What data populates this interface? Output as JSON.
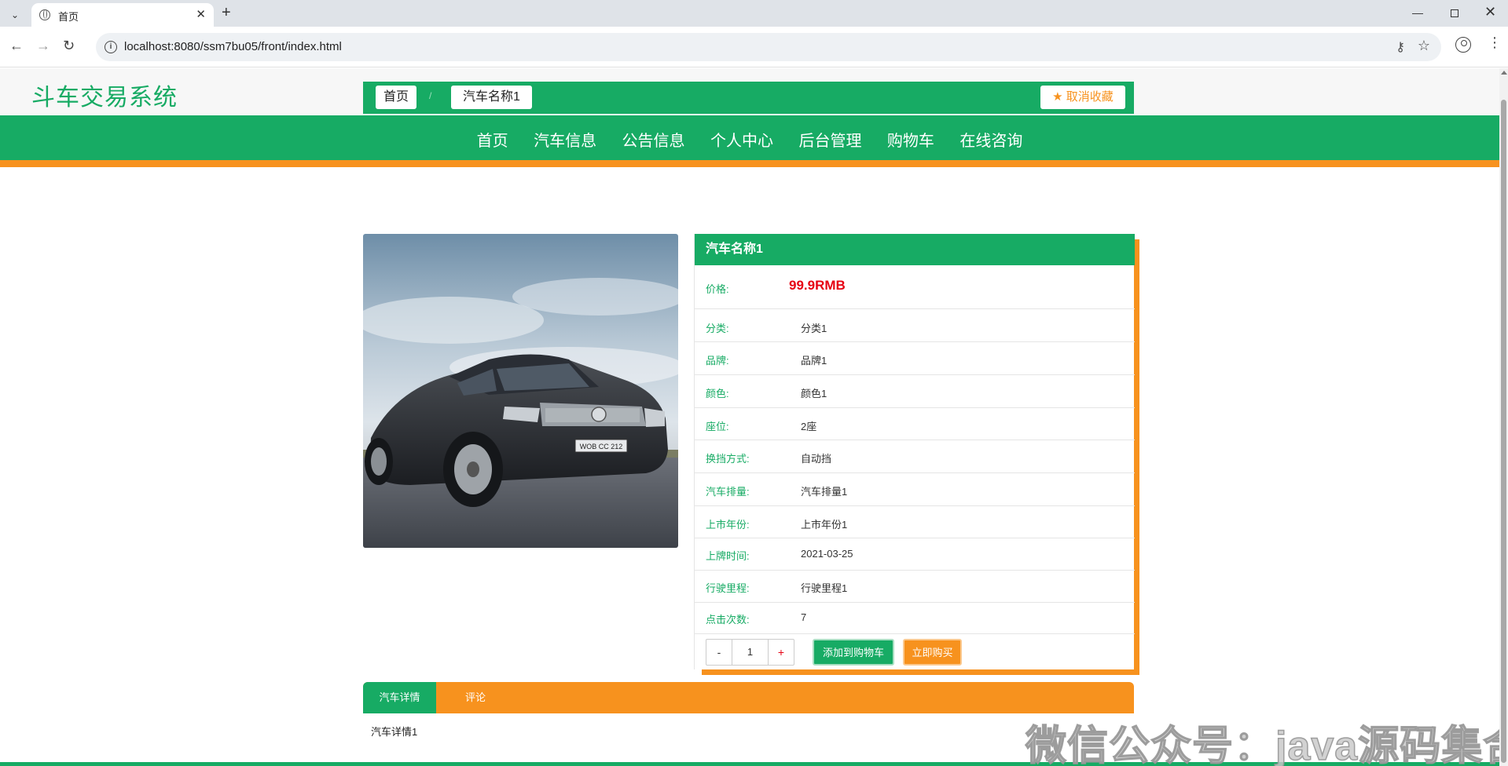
{
  "browser": {
    "tab_title": "首页",
    "url": "localhost:8080/ssm7bu05/front/index.html"
  },
  "site": {
    "title": "斗车交易系统",
    "nav": [
      "首页",
      "汽车信息",
      "公告信息",
      "个人中心",
      "后台管理",
      "购物车",
      "在线咨询"
    ]
  },
  "breadcrumb": {
    "home": "首页",
    "separator": "/",
    "current": "汽车名称1",
    "favorite_label": "取消收藏"
  },
  "product": {
    "name": "汽车名称1",
    "price_label": "价格:",
    "price_value": "99.9RMB",
    "attributes": [
      {
        "label": "分类:",
        "value": "分类1"
      },
      {
        "label": "品牌:",
        "value": "品牌1"
      },
      {
        "label": "颜色:",
        "value": "颜色1"
      },
      {
        "label": "座位:",
        "value": "2座"
      },
      {
        "label": "换挡方式:",
        "value": "自动挡"
      },
      {
        "label": "汽车排量:",
        "value": "汽车排量1"
      },
      {
        "label": "上市年份:",
        "value": "上市年份1"
      },
      {
        "label": "上牌时间:",
        "value": "2021-03-25"
      },
      {
        "label": "行驶里程:",
        "value": "行驶里程1"
      },
      {
        "label": "点击次数:",
        "value": "7"
      }
    ],
    "quantity": "1",
    "minus": "-",
    "plus": "+",
    "add_to_cart": "添加到购物车",
    "buy_now": "立即购买",
    "plate_text": "WOB CC 212"
  },
  "tabs": {
    "items": [
      "汽车详情",
      "评论"
    ],
    "content": "汽车详情1"
  },
  "watermark": "微信公众号：java源码集合",
  "colors": {
    "green": "#17ab64",
    "orange": "#f7921e",
    "price_red": "#e60012"
  }
}
